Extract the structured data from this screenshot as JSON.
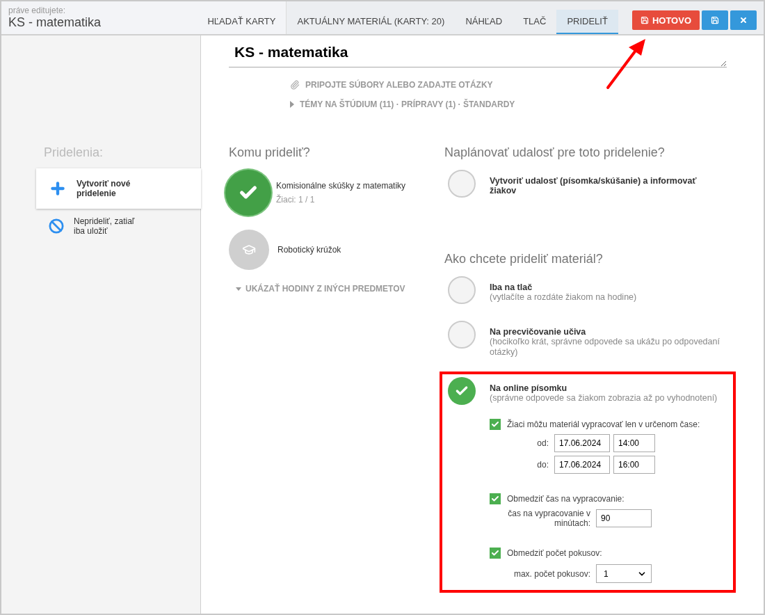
{
  "header": {
    "caption": "práve editujete:",
    "title": "KS - matematika"
  },
  "tabs": [
    {
      "label": "HĽADAŤ KARTY",
      "selected": false
    },
    {
      "label": "AKTUÁLNY MATERIÁL (KARTY: 20)",
      "selected": false
    },
    {
      "label": "NÁHĽAD",
      "selected": false
    },
    {
      "label": "TLAČ",
      "selected": false
    },
    {
      "label": "PRIDELIŤ",
      "selected": true
    }
  ],
  "actions": [
    {
      "kind": "done",
      "label": "HOTOVO"
    },
    {
      "kind": "save"
    },
    {
      "kind": "close"
    }
  ],
  "sidebar": {
    "heading": "Pridelenia:",
    "items": [
      {
        "kind": "create",
        "label": "Vytvoriť nové pridelenie",
        "selected": true
      },
      {
        "kind": "skip",
        "label": "Neprideliť, zatiaľ iba uložiť",
        "selected": false
      }
    ]
  },
  "editor": {
    "title": "KS - matematika",
    "attach": "PRIPOJTE SÚBORY ALEBO ZADAJTE OTÁZKY",
    "meta": "TÉMY NA ŠTÚDIUM (11) · PRÍPRAVY (1) · ŠTANDARDY"
  },
  "recipients": {
    "heading": "Komu prideliť?",
    "groups": [
      {
        "name": "Komisionálne skúšky z matematiky",
        "count": "Žiaci: 1 / 1",
        "selected": true
      },
      {
        "name": "Robotický krúžok",
        "selected": false
      }
    ],
    "more": "UKÁZAŤ HODINY Z INÝCH PREDMETOV"
  },
  "event": {
    "heading": "Naplánovať udalosť pre toto pridelenie?",
    "option": {
      "label": "Vytvoriť udalosť (písomka/skúšanie) a informovať žiakov",
      "selected": false
    }
  },
  "mode": {
    "heading": "Ako chcete prideliť materiál?",
    "options": [
      {
        "label": "Iba na tlač",
        "note": "(vytlačíte a rozdáte žiakom na hodine)",
        "selected": false,
        "highlighted": false
      },
      {
        "label": "Na precvičovanie učiva",
        "note": "(hocikoľko krát, správne odpovede sa ukážu po odpovedaní otázky)",
        "selected": false,
        "highlighted": false
      },
      {
        "label": "Na online písomku",
        "note": "(správne odpovede sa žiakom zobrazia až po vyhodnotení)",
        "selected": true,
        "highlighted": true
      }
    ]
  },
  "online_settings": {
    "time_window": {
      "checked": true,
      "label": "Žiaci môžu materiál vypracovať len v určenom čase:",
      "from_label": "od:",
      "from_date": "17.06.2024",
      "from_time": "14:00",
      "to_label": "do:",
      "to_date": "17.06.2024",
      "to_time": "16:00"
    },
    "time_limit": {
      "checked": true,
      "label": "Obmedziť čas na vypracovanie:",
      "field_label": "čas na vypracovanie v minútach:",
      "value": "90"
    },
    "attempts": {
      "checked": true,
      "label": "Obmedziť počet pokusov:",
      "field_label": "max. počet pokusov:",
      "value": "1"
    }
  }
}
